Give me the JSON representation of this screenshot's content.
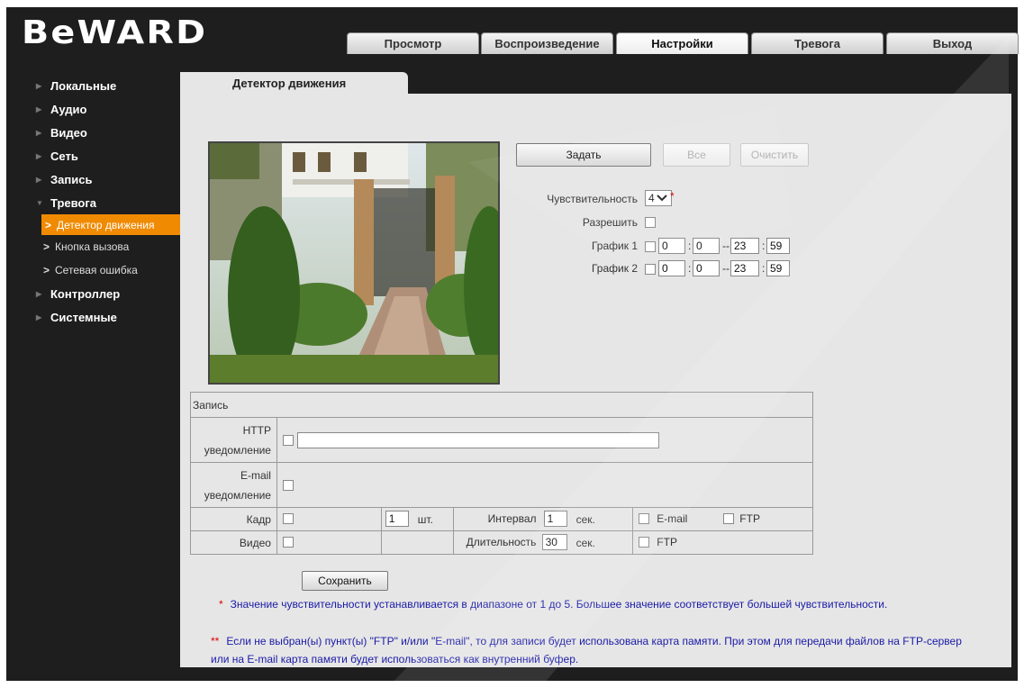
{
  "brand": {
    "logo_text": "BeWARD"
  },
  "nav": {
    "tabs": [
      {
        "label": "Просмотр",
        "active": false
      },
      {
        "label": "Воспроизведение",
        "active": false
      },
      {
        "label": "Настройки",
        "active": true
      },
      {
        "label": "Тревога",
        "active": false
      },
      {
        "label": "Выход",
        "active": false
      }
    ]
  },
  "sidebar": {
    "items": [
      {
        "label": "Локальные"
      },
      {
        "label": "Аудио"
      },
      {
        "label": "Видео"
      },
      {
        "label": "Сеть"
      },
      {
        "label": "Запись"
      },
      {
        "label": "Тревога",
        "expanded": true
      }
    ],
    "sub_items": [
      {
        "label": "Детектор движения",
        "active": true
      },
      {
        "label": "Кнопка вызова"
      },
      {
        "label": "Сетевая ошибка"
      }
    ],
    "items_after": [
      {
        "label": "Контроллер"
      },
      {
        "label": "Системные"
      }
    ]
  },
  "page": {
    "tab_title": "Детектор движения"
  },
  "buttons": {
    "set": "Задать",
    "all": "Все",
    "clear": "Очистить",
    "save": "Сохранить"
  },
  "settings": {
    "sensitivity_label": "Чувствительность",
    "sensitivity_value": "4",
    "sensitivity_star": "*",
    "enable_label": "Разрешить",
    "schedule1_label": "График 1",
    "schedule1": {
      "start_h": "0",
      "start_m": "0",
      "end_h": "23",
      "end_m": "59"
    },
    "schedule2_label": "График 2",
    "schedule2": {
      "start_h": "0",
      "start_m": "0",
      "end_h": "23",
      "end_m": "59"
    }
  },
  "record": {
    "header": "Запись",
    "http_label_1": "HTTP",
    "http_label_2": "уведомление",
    "http_url": "",
    "email_label_1": "E-mail",
    "email_label_2": "уведомление",
    "frame_label": "Кадр",
    "frame_count": "1",
    "frame_unit": "шт.",
    "interval_label": "Интервал",
    "interval_value": "1",
    "interval_unit": "сек.",
    "email_opt": "E-mail",
    "ftp_opt": "FTP",
    "video_label": "Видео",
    "duration_label": "Длительность",
    "duration_value": "30",
    "duration_unit": "сек.",
    "video_ftp_opt": "FTP"
  },
  "notes": {
    "note1_mark": "*",
    "note1": "Значение чувствительности устанавливается в диапазоне от 1 до 5. Большее значение соответствует большей чувствительности.",
    "note2_mark": "**",
    "note2_line1": "Если не выбран(ы) пункт(ы) \"FTP\" и/или \"E-mail\", то для записи будет использована карта памяти. При этом для передачи файлов на FTP-сервер",
    "note2_line2": "или на E-mail карта памяти будет использоваться как внутренний буфер."
  },
  "colors": {
    "accent": "#f08a00",
    "panel": "#e6e6e6",
    "frame": "#1e1e1e",
    "note_text": "#1a1aa8"
  }
}
